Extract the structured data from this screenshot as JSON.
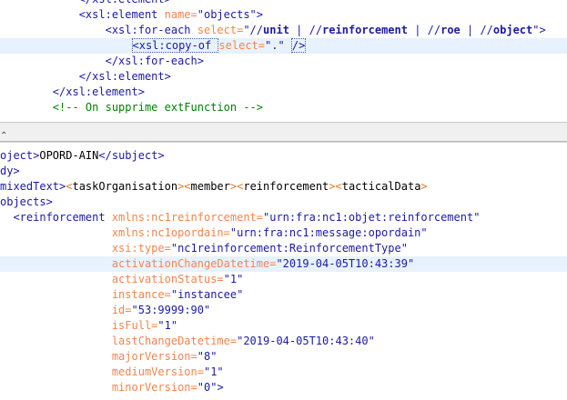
{
  "xsl_editor": {
    "lines": [
      {
        "indent": "            ",
        "parts": [
          [
            "tag",
            "</xsl:element>"
          ]
        ]
      },
      {
        "indent": "            ",
        "parts": [
          [
            "tag",
            "<xsl:element "
          ],
          [
            "attr",
            "name="
          ],
          [
            "val",
            "\"objects\""
          ],
          [
            "tag",
            ">"
          ]
        ]
      },
      {
        "indent": "                ",
        "parts": [
          [
            "tag",
            "<xsl:for-each "
          ],
          [
            "attr",
            "select="
          ],
          [
            "val",
            "\"//"
          ],
          [
            "valb",
            "unit"
          ],
          [
            "val",
            " | //"
          ],
          [
            "valb",
            "reinforcement"
          ],
          [
            "val",
            " | //"
          ],
          [
            "valb",
            "roe"
          ],
          [
            "val",
            " | //"
          ],
          [
            "valb",
            "object"
          ],
          [
            "val",
            "\""
          ],
          [
            "tag",
            ">"
          ]
        ]
      },
      {
        "indent": "                    ",
        "highlight": true,
        "parts": [
          [
            "tagbox",
            "<xsl:copy-of "
          ],
          [
            "attr",
            "select="
          ],
          [
            "val",
            "\".\" "
          ],
          [
            "tagbox2",
            "/>"
          ]
        ]
      },
      {
        "indent": "                ",
        "parts": [
          [
            "tag",
            "</xsl:for-each>"
          ]
        ]
      },
      {
        "indent": "            ",
        "parts": [
          [
            "tag",
            "</xsl:element>"
          ]
        ]
      },
      {
        "indent": "        ",
        "parts": [
          [
            "tag",
            "</xsl:element>"
          ]
        ]
      },
      {
        "indent": "        ",
        "parts": [
          [
            "cmt",
            "<!-- On supprime extFunction -->"
          ]
        ]
      }
    ]
  },
  "divider": {
    "grip": "⌃"
  },
  "xml_editor": {
    "lines": [
      {
        "indent": "",
        "parts": [
          [
            "tag",
            "oject>"
          ],
          [
            "txt",
            "OPORD-AIN"
          ],
          [
            "tag",
            "</subject>"
          ]
        ]
      },
      {
        "indent": "",
        "parts": [
          [
            "tag",
            "dy>"
          ]
        ]
      },
      {
        "indent": "",
        "parts": [
          [
            "tag",
            "mixedText>"
          ],
          [
            "ent",
            "&lt;"
          ],
          [
            "txt",
            "taskOrganisation"
          ],
          [
            "ent",
            "&gt;&lt;"
          ],
          [
            "txt",
            "member"
          ],
          [
            "ent",
            "&gt;&lt;"
          ],
          [
            "txt",
            "reinforcement"
          ],
          [
            "ent",
            "&gt;&lt;"
          ],
          [
            "txt",
            "tacticalData"
          ],
          [
            "ent",
            "&gt;"
          ]
        ]
      },
      {
        "indent": "",
        "parts": [
          [
            "tag",
            "objects>"
          ]
        ]
      },
      {
        "indent": "  ",
        "parts": [
          [
            "tag",
            "<reinforcement "
          ],
          [
            "attr",
            "xmlns:nc1reinforcement="
          ],
          [
            "val",
            "\"urn:fra:nc1:objet:reinforcement\""
          ]
        ]
      },
      {
        "indent": "                 ",
        "parts": [
          [
            "attr",
            "xmlns:nc1opordain="
          ],
          [
            "val",
            "\"urn:fra:nc1:message:opordain\""
          ]
        ]
      },
      {
        "indent": "                 ",
        "parts": [
          [
            "attr",
            "xsi:type="
          ],
          [
            "val",
            "\"nc1reinforcement:ReinforcementType\""
          ]
        ]
      },
      {
        "indent": "                 ",
        "highlight": true,
        "parts": [
          [
            "attr",
            "activationChangeDatetime="
          ],
          [
            "val",
            "\"2019-04-05T10:43:39\""
          ]
        ]
      },
      {
        "indent": "                 ",
        "parts": [
          [
            "attr",
            "activationStatus="
          ],
          [
            "val",
            "\"1\""
          ]
        ]
      },
      {
        "indent": "                 ",
        "parts": [
          [
            "attr",
            "instance="
          ],
          [
            "val",
            "\"instancee\""
          ]
        ]
      },
      {
        "indent": "                 ",
        "parts": [
          [
            "attr",
            "id="
          ],
          [
            "val",
            "\"53:9999:90\""
          ]
        ]
      },
      {
        "indent": "                 ",
        "parts": [
          [
            "attr",
            "isFull="
          ],
          [
            "val",
            "\"1\""
          ]
        ]
      },
      {
        "indent": "                 ",
        "parts": [
          [
            "attr",
            "lastChangeDatetime="
          ],
          [
            "val",
            "\"2019-04-05T10:43:40\""
          ]
        ]
      },
      {
        "indent": "                 ",
        "parts": [
          [
            "attr",
            "majorVersion="
          ],
          [
            "val",
            "\"8\""
          ]
        ]
      },
      {
        "indent": "                 ",
        "parts": [
          [
            "attr",
            "mediumVersion="
          ],
          [
            "val",
            "\"1\""
          ]
        ]
      },
      {
        "indent": "                 ",
        "parts": [
          [
            "attr",
            "minorVersion="
          ],
          [
            "val",
            "\"0\""
          ],
          [
            "tag",
            ">"
          ]
        ]
      }
    ]
  }
}
